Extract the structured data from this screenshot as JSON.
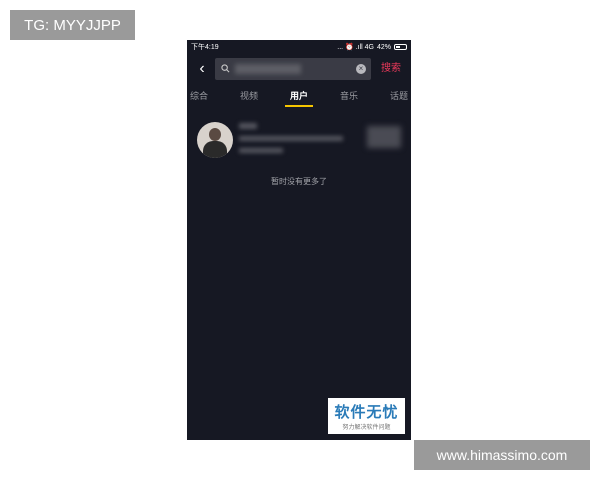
{
  "overlay": {
    "tg_label": "TG: MYYJJPP",
    "site_label": "www.himassimo.com"
  },
  "status_bar": {
    "time": "下午4:19",
    "indicators": "... ⏰ .ıll 4G",
    "battery": "42%"
  },
  "search": {
    "back_icon": "chevron-left-icon",
    "query": "",
    "search_button": "搜索"
  },
  "tabs": [
    {
      "label": "综合"
    },
    {
      "label": "视频"
    },
    {
      "label": "用户",
      "active": true
    },
    {
      "label": "音乐"
    },
    {
      "label": "话题"
    }
  ],
  "results": {
    "end_text": "暂时没有更多了"
  },
  "watermark": {
    "title": "软件无忧",
    "subtitle": "努力解决软件问题"
  },
  "colors": {
    "background": "#161823",
    "accent_red": "#e8395a",
    "tab_indicator": "#f5c500"
  }
}
